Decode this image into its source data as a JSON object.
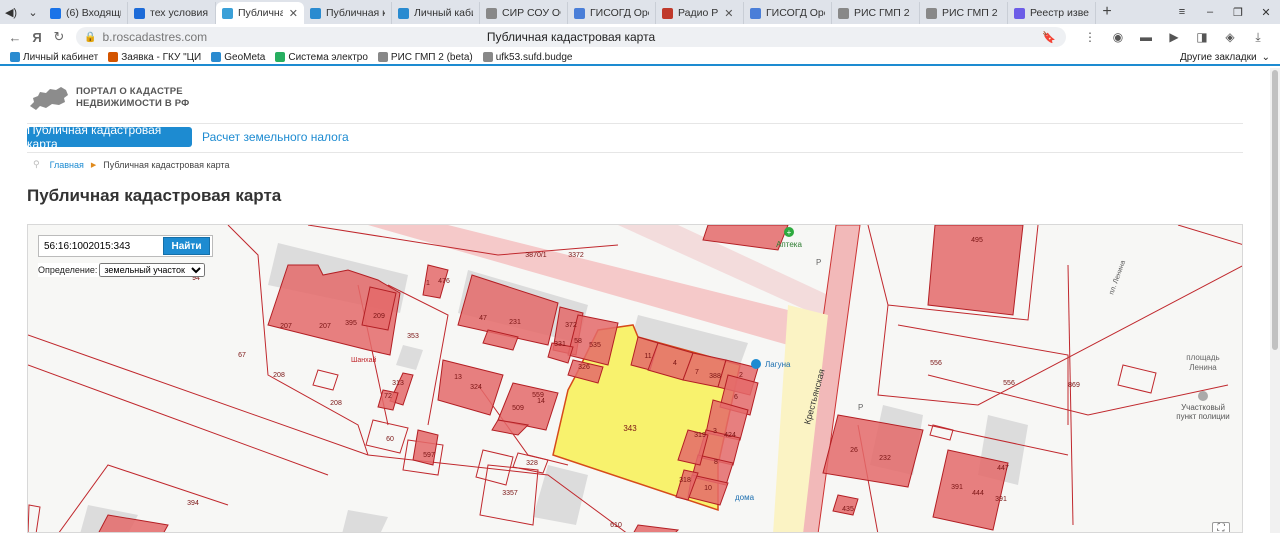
{
  "browser": {
    "tabs": [
      {
        "label": "(6) Входящие",
        "color": "#1a73e8"
      },
      {
        "label": "тех условия о",
        "color": "#1d6bd8"
      },
      {
        "label": "Публичная",
        "color": "#3aa0d8",
        "active": true
      },
      {
        "label": "Публичная ка",
        "color": "#2a8bd0"
      },
      {
        "label": "Личный кабин",
        "color": "#2a8bd0"
      },
      {
        "label": "СИР СОУ ОО",
        "color": "#888888"
      },
      {
        "label": "ГИСОГД Орен",
        "color": "#4a7ed8"
      },
      {
        "label": "Радио Р",
        "color": "#c0392b"
      },
      {
        "label": "ГИСОГД Орен",
        "color": "#4a7ed8"
      },
      {
        "label": "РИС ГМП 2 (b",
        "color": "#888888"
      },
      {
        "label": "РИС ГМП 2 (b",
        "color": "#888888"
      },
      {
        "label": "Реестр извеш",
        "color": "#6c5ce7"
      }
    ],
    "url_host": "b.roscadastres.com",
    "page_title": "Публичная кадастровая карта",
    "bookmarks": [
      {
        "label": "Личный кабинет",
        "color": "#2a8bd0"
      },
      {
        "label": "Заявка - ГКУ \"ЦИ",
        "color": "#d35400"
      },
      {
        "label": "GeoMeta",
        "color": "#2a8bd0"
      },
      {
        "label": "Система электро",
        "color": "#27ae60"
      },
      {
        "label": "РИС ГМП 2 (beta)",
        "color": "#888888"
      },
      {
        "label": "ufk53.sufd.budge",
        "color": "#888888"
      }
    ],
    "other_bookmarks": "Другие закладки"
  },
  "site": {
    "logo_line1": "ПОРТАЛ О КАДАСТРЕ",
    "logo_line2": "НЕДВИЖИМОСТИ В РФ",
    "tab_public_map": "Публичная кадастровая карта",
    "tab_tax": "Расчет земельного налога",
    "breadcrumb_home": "Главная",
    "breadcrumb_current": "Публичная кадастровая карта",
    "heading": "Публичная кадастровая карта"
  },
  "map": {
    "search_value": "56:16:1002015:343",
    "search_button": "Найти",
    "definition_label": "Определение:",
    "definition_value": "земельный участок",
    "parcel_labels": [
      "3870/1",
      "3372",
      "94",
      "1",
      "476",
      "209",
      "395",
      "207",
      "207",
      "353",
      "67",
      "208",
      "208",
      "47",
      "231",
      "372",
      "58",
      "535",
      "331",
      "326",
      "13",
      "324",
      "559",
      "14",
      "509",
      "11",
      "4",
      "7",
      "388",
      "2",
      "6",
      "343",
      "319",
      "3",
      "424",
      "8",
      "318",
      "10",
      "72",
      "313",
      "60",
      "597",
      "328",
      "3357",
      "394",
      "610",
      "495",
      "556",
      "556",
      "869",
      "26",
      "232",
      "391",
      "444",
      "391",
      "447",
      "435"
    ],
    "poi": {
      "pharmacy": "Аптека",
      "laguna": "Лагуна",
      "street": "Крестьянская",
      "lenin_lane": "пл. Ленина",
      "square": "площадь\nЛенина",
      "police": "Участковый\nпункт полиции",
      "houses": "дома",
      "shanghai": "Шанхай",
      "parking1": "Р",
      "parking2": "Р"
    }
  }
}
